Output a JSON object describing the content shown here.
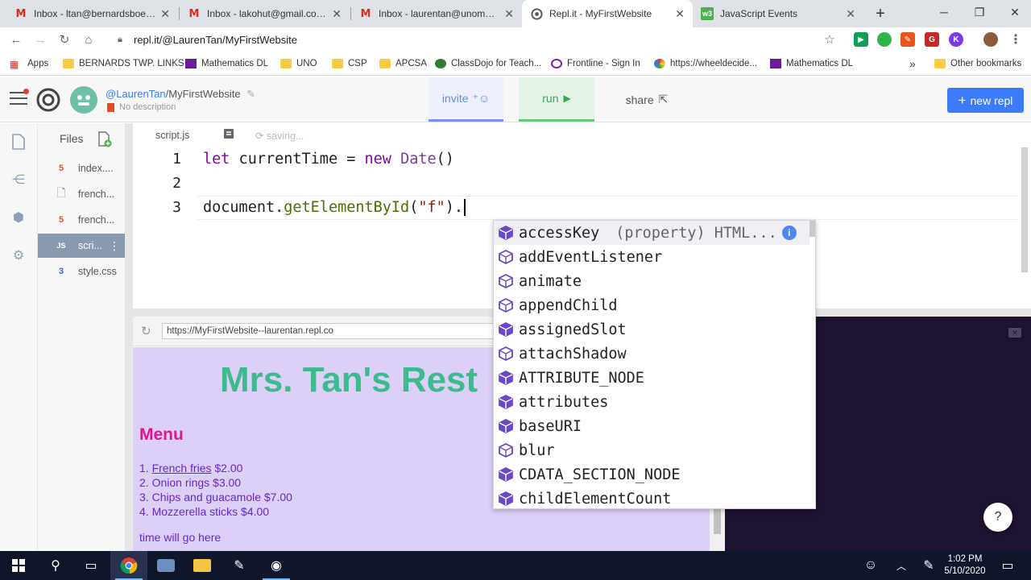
{
  "browser": {
    "tabs": [
      {
        "title": "Inbox - ltan@bernardsboe.com",
        "icon": "gmail-icon"
      },
      {
        "title": "Inbox - lakohut@gmail.com - G",
        "icon": "gmail-icon"
      },
      {
        "title": "Inbox - laurentan@unomaha.e",
        "icon": "gmail-icon"
      },
      {
        "title": "Repl.it - MyFirstWebsite",
        "icon": "replit-icon",
        "active": true
      },
      {
        "title": "JavaScript Events",
        "icon": "w3schools-icon"
      }
    ],
    "new_tab": "+",
    "window_controls": {
      "minimize": "─",
      "maximize": "❐",
      "close": "✕"
    },
    "url": "repl.it/@LaurenTan/MyFirstWebsite",
    "bookmarks": [
      {
        "label": "Apps",
        "icon": "apps-grid-icon"
      },
      {
        "label": "BERNARDS TWP. LINKS",
        "icon": "folder-icon"
      },
      {
        "label": "Mathematics DL",
        "icon": "site-icon"
      },
      {
        "label": "UNO",
        "icon": "folder-icon"
      },
      {
        "label": "CSP",
        "icon": "folder-icon"
      },
      {
        "label": "APCSA",
        "icon": "folder-icon"
      },
      {
        "label": "ClassDojo for Teach...",
        "icon": "classdojo-icon"
      },
      {
        "label": "Frontline - Sign In",
        "icon": "frontline-icon"
      },
      {
        "label": "https://wheeldecide...",
        "icon": "wheel-icon"
      },
      {
        "label": "Mathematics DL",
        "icon": "site-icon"
      }
    ],
    "more_bookmarks": "»",
    "other_bookmarks": "Other bookmarks"
  },
  "repl": {
    "owner": "@LaurenTan",
    "project": "/MyFirstWebsite",
    "description": "No description",
    "invite_label": "invite",
    "run_label": "run",
    "share_label": "share",
    "new_repl_label": "new repl",
    "files_title": "Files",
    "files": [
      {
        "name": "index....",
        "type": "html"
      },
      {
        "name": "french...",
        "type": "file"
      },
      {
        "name": "french...",
        "type": "html"
      },
      {
        "name": "scri...",
        "type": "js",
        "selected": true
      },
      {
        "name": "style.css",
        "type": "css"
      }
    ],
    "editor_tab": "script.js",
    "saving_text": "saving..."
  },
  "code": {
    "line_numbers": [
      "1",
      "2",
      "3"
    ],
    "l1_kw": "let",
    "l1_mid": " currentTime = ",
    "l1_new": "new",
    "l1_sp": " ",
    "l1_date": "Date",
    "l1_end": "()",
    "l3_a": "document.",
    "l3_meth": "getElementById",
    "l3_b": "(",
    "l3_str": "\"f\"",
    "l3_c": ")."
  },
  "autocomplete": {
    "items": [
      {
        "label": "accessKey",
        "detail": "(property) HTML...",
        "kind": "property",
        "selected": true
      },
      {
        "label": "addEventListener",
        "kind": "method"
      },
      {
        "label": "animate",
        "kind": "method"
      },
      {
        "label": "appendChild",
        "kind": "method"
      },
      {
        "label": "assignedSlot",
        "kind": "property"
      },
      {
        "label": "attachShadow",
        "kind": "method"
      },
      {
        "label": "ATTRIBUTE_NODE",
        "kind": "property"
      },
      {
        "label": "attributes",
        "kind": "property"
      },
      {
        "label": "baseURI",
        "kind": "property"
      },
      {
        "label": "blur",
        "kind": "method"
      },
      {
        "label": "CDATA_SECTION_NODE",
        "kind": "property"
      },
      {
        "label": "childElementCount",
        "kind": "property"
      }
    ]
  },
  "preview": {
    "url": "https://MyFirstWebsite--laurentan.repl.co",
    "heading": "Mrs. Tan's Rest",
    "menu_title": "Menu",
    "menu": [
      {
        "num": "1. ",
        "name": "French fries",
        "price": " $2.00",
        "link": true
      },
      {
        "num": "2. ",
        "name": "Onion rings",
        "price": " $3.00"
      },
      {
        "num": "3. ",
        "name": "Chips and guacamole",
        "price": " $7.00"
      },
      {
        "num": "4. ",
        "name": "Mozzerella sticks",
        "price": " $4.00"
      }
    ],
    "time_text": "time will go here"
  },
  "help_label": "?",
  "taskbar": {
    "time": "1:02 PM",
    "date": "5/10/2020"
  },
  "colors": {
    "accent_blue": "#3d7bfd",
    "run_green": "#69c878",
    "preview_bg": "#dcd0f7",
    "heading_green": "#3dba8e",
    "menu_pink": "#e0178e"
  }
}
